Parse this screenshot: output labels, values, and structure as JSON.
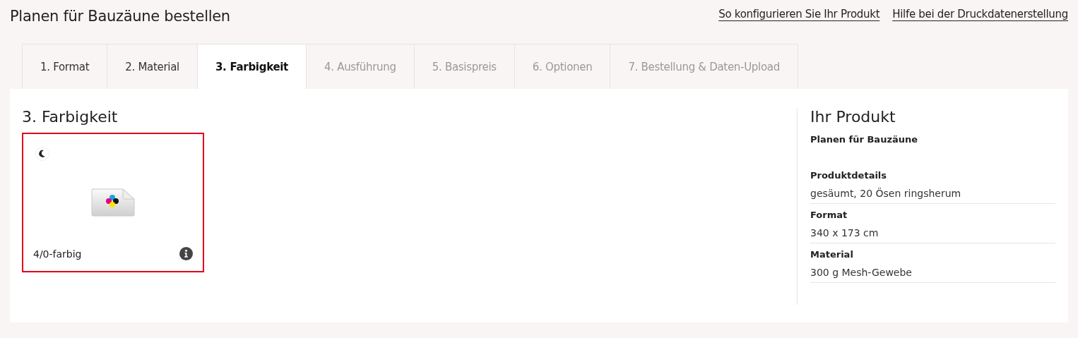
{
  "page_title": "Planen für Bauzäune bestellen",
  "header_links": [
    "So konfigurieren Sie Ihr Produkt",
    "Hilfe bei der Druckdatenerstellung"
  ],
  "tabs": [
    {
      "label": "1. Format",
      "selected": false,
      "disabled": false
    },
    {
      "label": "2. Material",
      "selected": false,
      "disabled": false
    },
    {
      "label": "3. Farbigkeit",
      "selected": true,
      "disabled": false
    },
    {
      "label": "4. Ausführung",
      "selected": false,
      "disabled": true
    },
    {
      "label": "5. Basispreis",
      "selected": false,
      "disabled": true
    },
    {
      "label": "6. Optionen",
      "selected": false,
      "disabled": true
    },
    {
      "label": "7. Bestellung & Daten-Upload",
      "selected": false,
      "disabled": true
    }
  ],
  "section_title": "3. Farbigkeit",
  "options": [
    {
      "label": "4/0-farbig",
      "selected": true
    }
  ],
  "summary": {
    "title": "Ihr Produkt",
    "product": "Planen für Bauzäune",
    "details": [
      {
        "label": "Produktdetails",
        "value": "gesäumt, 20 Ösen ringsherum"
      },
      {
        "label": "Format",
        "value": "340 x 173 cm"
      },
      {
        "label": "Material",
        "value": "300 g Mesh-Gewebe"
      }
    ]
  }
}
